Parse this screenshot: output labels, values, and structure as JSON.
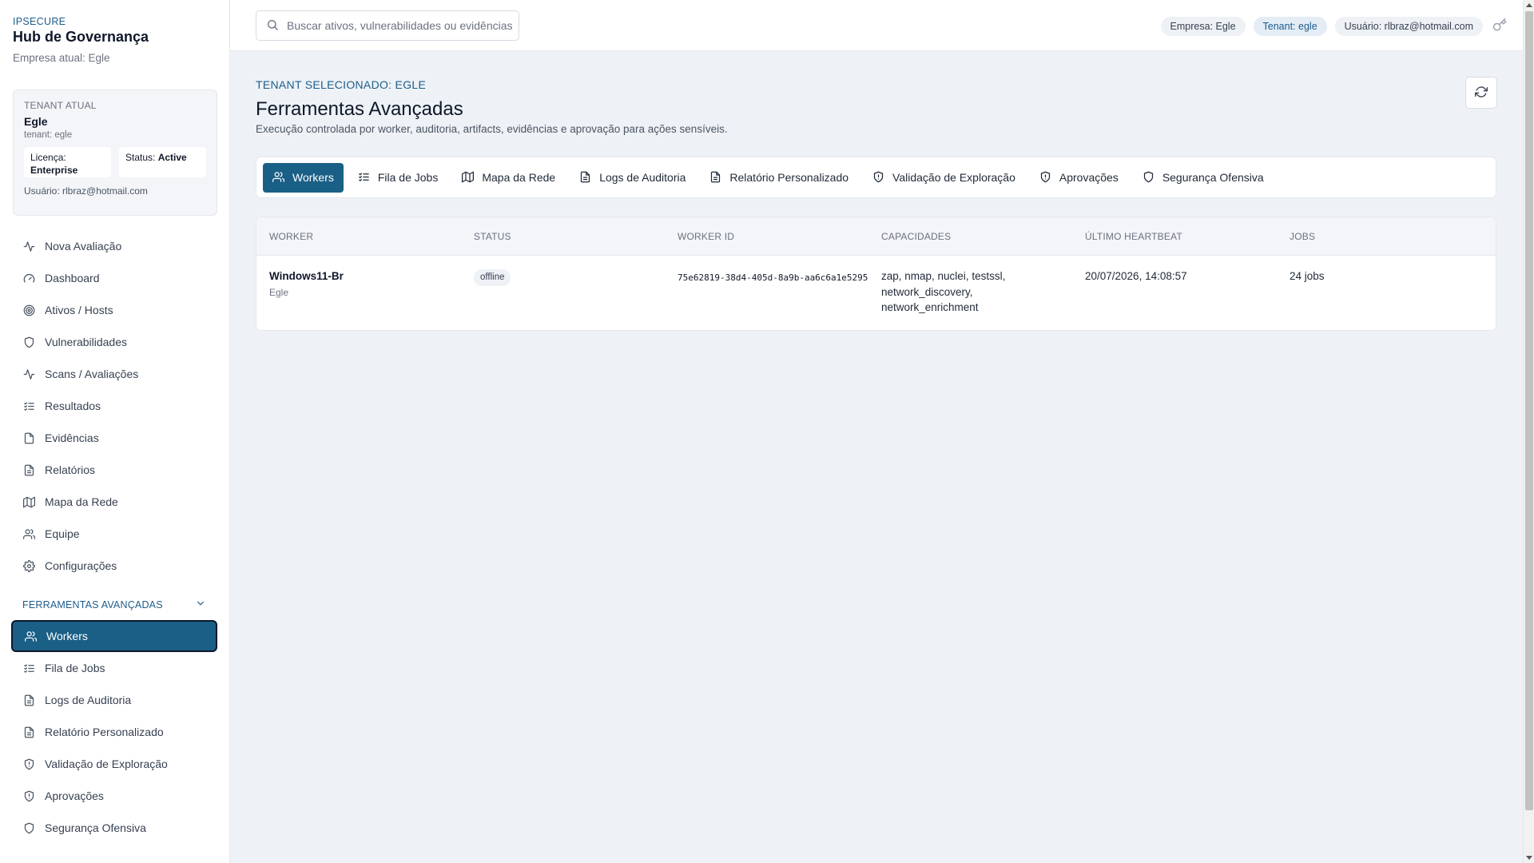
{
  "brand": {
    "small": "IPSECURE",
    "title": "Hub de Governança",
    "company": "Empresa atual: Egle"
  },
  "tenant_card": {
    "label": "TENANT ATUAL",
    "name": "Egle",
    "slug": "tenant: egle",
    "license_label": "Licença:",
    "license_value": "Enterprise",
    "status_label": "Status:",
    "status_value": "Active",
    "user": "Usuário: rlbraz@hotmail.com"
  },
  "nav": {
    "items": [
      {
        "label": "Nova Avaliação",
        "icon": "activity-icon"
      },
      {
        "label": "Dashboard",
        "icon": "gauge-icon"
      },
      {
        "label": "Ativos / Hosts",
        "icon": "target-icon"
      },
      {
        "label": "Vulnerabilidades",
        "icon": "shield-icon"
      },
      {
        "label": "Scans / Avaliações",
        "icon": "activity-icon"
      },
      {
        "label": "Resultados",
        "icon": "list-checks-icon"
      },
      {
        "label": "Evidências",
        "icon": "file-icon"
      },
      {
        "label": "Relatórios",
        "icon": "file-text-icon"
      },
      {
        "label": "Mapa da Rede",
        "icon": "map-icon"
      },
      {
        "label": "Equipe",
        "icon": "users-icon"
      },
      {
        "label": "Configurações",
        "icon": "gear-icon"
      }
    ],
    "section_title": "FERRAMENTAS AVANÇADAS",
    "tool_items": [
      {
        "label": "Workers",
        "icon": "users-icon"
      },
      {
        "label": "Fila de Jobs",
        "icon": "list-checks-icon"
      },
      {
        "label": "Logs de Auditoria",
        "icon": "file-text-icon"
      },
      {
        "label": "Relatório Personalizado",
        "icon": "file-text-icon"
      },
      {
        "label": "Validação de Exploração",
        "icon": "shield-alert-icon"
      },
      {
        "label": "Aprovações",
        "icon": "shield-alert-icon"
      },
      {
        "label": "Segurança Ofensiva",
        "icon": "shield-icon"
      }
    ]
  },
  "topbar": {
    "search_placeholder": "Buscar ativos, vulnerabilidades ou evidências",
    "company_pill": "Empresa: Egle",
    "tenant_pill": "Tenant: egle",
    "user_pill": "Usuário: rlbraz@hotmail.com"
  },
  "main": {
    "kicker": "TENANT SELECIONADO: EGLE",
    "title": "Ferramentas Avançadas",
    "description": "Execução controlada por worker, auditoria, artifacts, evidências e aprovação para ações sensíveis.",
    "tabs": [
      {
        "label": "Workers",
        "icon": "users-icon"
      },
      {
        "label": "Fila de Jobs",
        "icon": "list-checks-icon"
      },
      {
        "label": "Mapa da Rede",
        "icon": "map-icon"
      },
      {
        "label": "Logs de Auditoria",
        "icon": "file-text-icon"
      },
      {
        "label": "Relatório Personalizado",
        "icon": "file-text-icon"
      },
      {
        "label": "Validação de Exploração",
        "icon": "shield-alert-icon"
      },
      {
        "label": "Aprovações",
        "icon": "shield-alert-icon"
      },
      {
        "label": "Segurança Ofensiva",
        "icon": "shield-icon"
      }
    ],
    "table": {
      "headers": [
        "WORKER",
        "STATUS",
        "WORKER ID",
        "CAPACIDADES",
        "ÚLTIMO HEARTBEAT",
        "JOBS"
      ],
      "rows": [
        {
          "worker": "Windows11-Br",
          "company": "Egle",
          "status": "offline",
          "worker_id": "75e62819-38d4-405d-8a9b-aa6c6a1e5295",
          "capabilities_line1": "zap, nmap, nuclei, testssl,",
          "capabilities_line2": "network_discovery,",
          "capabilities_line3": "network_enrichment",
          "heartbeat": "20/07/2026, 14:08:57",
          "jobs": "24 jobs"
        }
      ]
    }
  },
  "colors": {
    "accent": "#1a5f86",
    "brand_text": "#1d5c8a",
    "background": "#eef2f6"
  }
}
